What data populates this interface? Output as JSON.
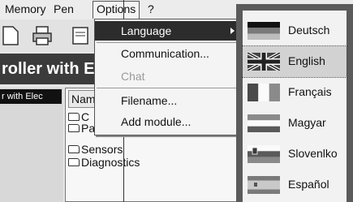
{
  "menubar": {
    "items": [
      {
        "label": "Memory"
      },
      {
        "label": "Pen"
      },
      {
        "label": "Options"
      },
      {
        "label": "?"
      }
    ]
  },
  "title_band": {
    "text": "roller with E"
  },
  "left_label": {
    "text": "r with Elec"
  },
  "tree": {
    "header": "Name",
    "items": [
      "C",
      "Parameters",
      "Sensors",
      "Diagnostics"
    ]
  },
  "options_menu": {
    "items": [
      {
        "label": "Language",
        "highlighted": true,
        "submenu": true
      },
      {
        "label": "Communication..."
      },
      {
        "label": "Chat",
        "disabled": true
      },
      {
        "label": "Filename..."
      },
      {
        "label": "Add module..."
      }
    ]
  },
  "language_menu": {
    "items": [
      {
        "label": "Deutsch",
        "icon": "german-flag-icon"
      },
      {
        "label": "English",
        "icon": "uk-flag-icon"
      },
      {
        "label": "Français",
        "icon": "french-flag-icon"
      },
      {
        "label": "Magyar",
        "icon": "hungarian-flag-icon"
      },
      {
        "label": "Slovenlko",
        "icon": "slovenian-flag-icon"
      },
      {
        "label": "Español",
        "icon": "spanish-flag-icon"
      }
    ]
  }
}
